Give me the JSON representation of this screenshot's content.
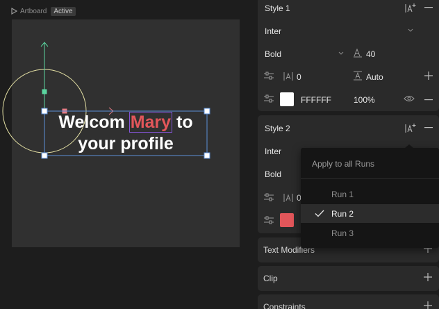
{
  "canvas": {
    "artboard_label": "Artboard",
    "artboard_state": "Active",
    "text_line1_a": "Welcom ",
    "text_run2": "Mary",
    "text_line1_b": " to",
    "text_line2": "your profile"
  },
  "style1": {
    "title": "Style 1",
    "font": "Inter",
    "weight": "Bold",
    "size": "40",
    "letter_spacing": "0",
    "line_height": "Auto",
    "color_hex": "FFFFFF",
    "opacity": "100%",
    "swatch_color": "#ffffff"
  },
  "style2": {
    "title": "Style 2",
    "font": "Inter",
    "weight": "Bold",
    "letter_spacing": "0",
    "swatch_color": "#e2565a"
  },
  "sections": {
    "text_modifiers": "Text Modifiers",
    "clip": "Clip",
    "constraints": "Constraints"
  },
  "runs_menu": {
    "apply_all": "Apply to all Runs",
    "items": [
      "Run 1",
      "Run 2",
      "Run 3"
    ],
    "selected": "Run 2"
  },
  "colors": {
    "accent_run": "#e2565a",
    "selection_blue": "#5b8fd9",
    "handle_green": "#5bd6a0",
    "guide_circle": "#e7e3a6",
    "handle_pink": "#e67d86"
  },
  "icons": {
    "play": "play-triangle-icon",
    "style_add": "add-text-style-icon",
    "minus": "minus-icon",
    "plus": "plus-icon",
    "eye": "eye-icon",
    "sliders": "sliders-icon",
    "chevron": "chevron-down-icon",
    "check": "checkmark-icon"
  }
}
